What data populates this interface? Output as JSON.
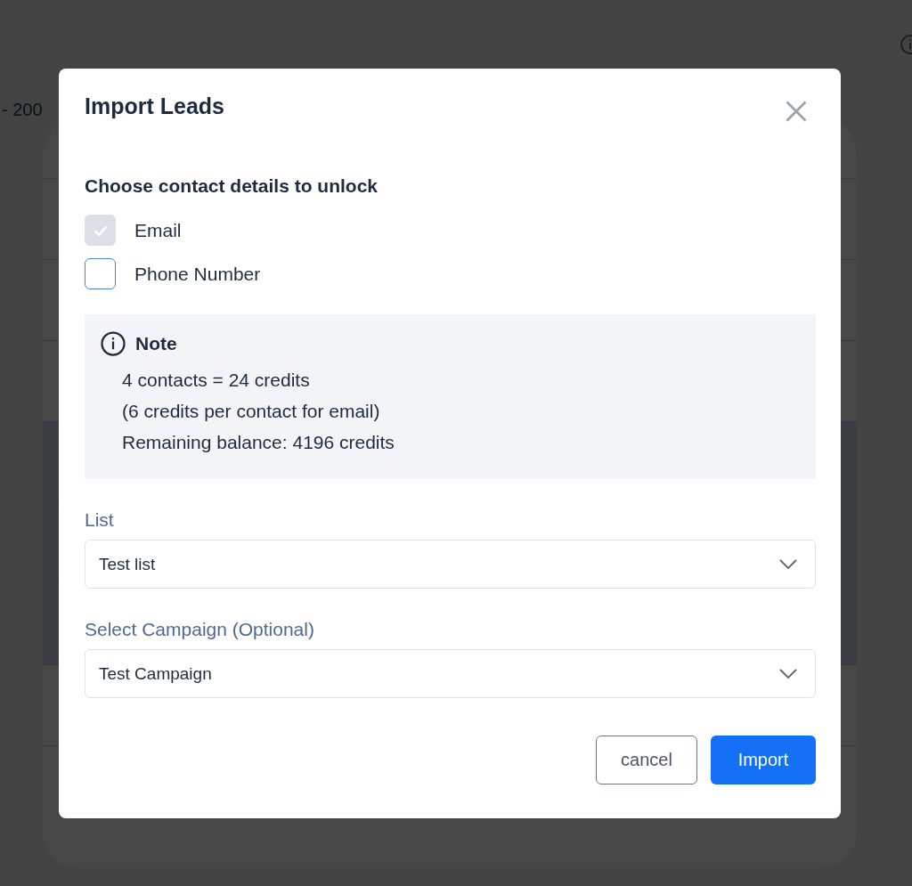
{
  "background": {
    "range_text": "- 200"
  },
  "dialog": {
    "title": "Import Leads",
    "section_title": "Choose contact details to unlock",
    "options": [
      {
        "label": "Email",
        "checked": true,
        "disabled": true
      },
      {
        "label": "Phone Number",
        "checked": false,
        "disabled": false
      }
    ],
    "note": {
      "title": "Note",
      "lines": [
        "4 contacts = 24 credits",
        "(6 credits per contact for email)",
        "Remaining balance: 4196 credits"
      ]
    },
    "fields": [
      {
        "label": "List",
        "value": "Test list"
      },
      {
        "label": "Select Campaign (Optional)",
        "value": "Test Campaign"
      }
    ],
    "buttons": [
      {
        "label": "cancel",
        "kind": "secondary"
      },
      {
        "label": "Import",
        "kind": "primary"
      }
    ]
  }
}
